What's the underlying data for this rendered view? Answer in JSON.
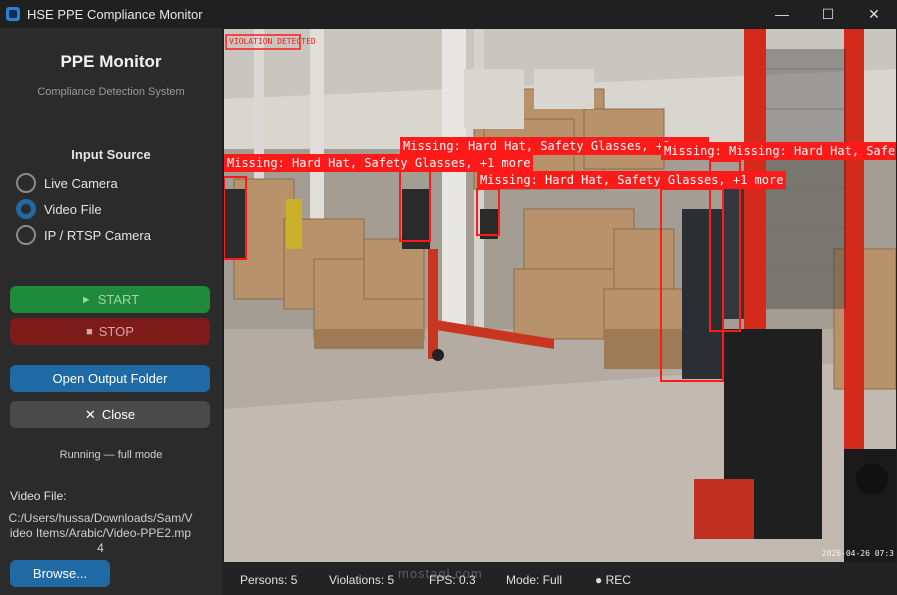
{
  "window": {
    "title": "HSE PPE Compliance Monitor",
    "controls": {
      "minimize": "—",
      "maximize": "☐",
      "close": "✕"
    }
  },
  "sidebar": {
    "app_title": "PPE Monitor",
    "app_subtitle": "Compliance Detection System",
    "input_source_title": "Input Source",
    "sources": [
      {
        "label": "Live Camera",
        "selected": false
      },
      {
        "label": "Video File",
        "selected": true
      },
      {
        "label": "IP / RTSP Camera",
        "selected": false
      }
    ],
    "start_label": "START",
    "stop_label": "STOP",
    "open_folder_label": "Open Output Folder",
    "close_label": "Close",
    "status_text": "Running — full mode",
    "video_file_label": "Video File:",
    "video_file_path": "C:/Users/hussa/Downloads/Sam/Video Items/Arabic/Video-PPE2.mp4",
    "browse_label": "Browse..."
  },
  "video": {
    "violation_banner": "VIOLATION DETECTED",
    "timestamp": "2026-04-26 07:3",
    "detections": [
      {
        "label": "Missing: Hard Hat, Safety Glasses, +1 more"
      },
      {
        "label": "Missing: Hard Hat, Safety Glasses, +1 more"
      },
      {
        "label": "Missing: Hard Hat, Safety Glasses, +1 more"
      },
      {
        "label": "Missing: Missing: Hard Hat, Safety Glasse"
      }
    ],
    "colors": {
      "violation": "#ff1a1a",
      "forklift": "#d42a1c"
    }
  },
  "statusbar": {
    "persons": "Persons: 5",
    "violations": "Violations: 5",
    "fps": "FPS: 0.3",
    "mode": "Mode: Full",
    "rec": "● REC"
  },
  "watermark": "mostaql.com",
  "colors": {
    "accent": "#1f6aa5",
    "start": "#1e8a3a",
    "stop": "#7d1a1a"
  }
}
